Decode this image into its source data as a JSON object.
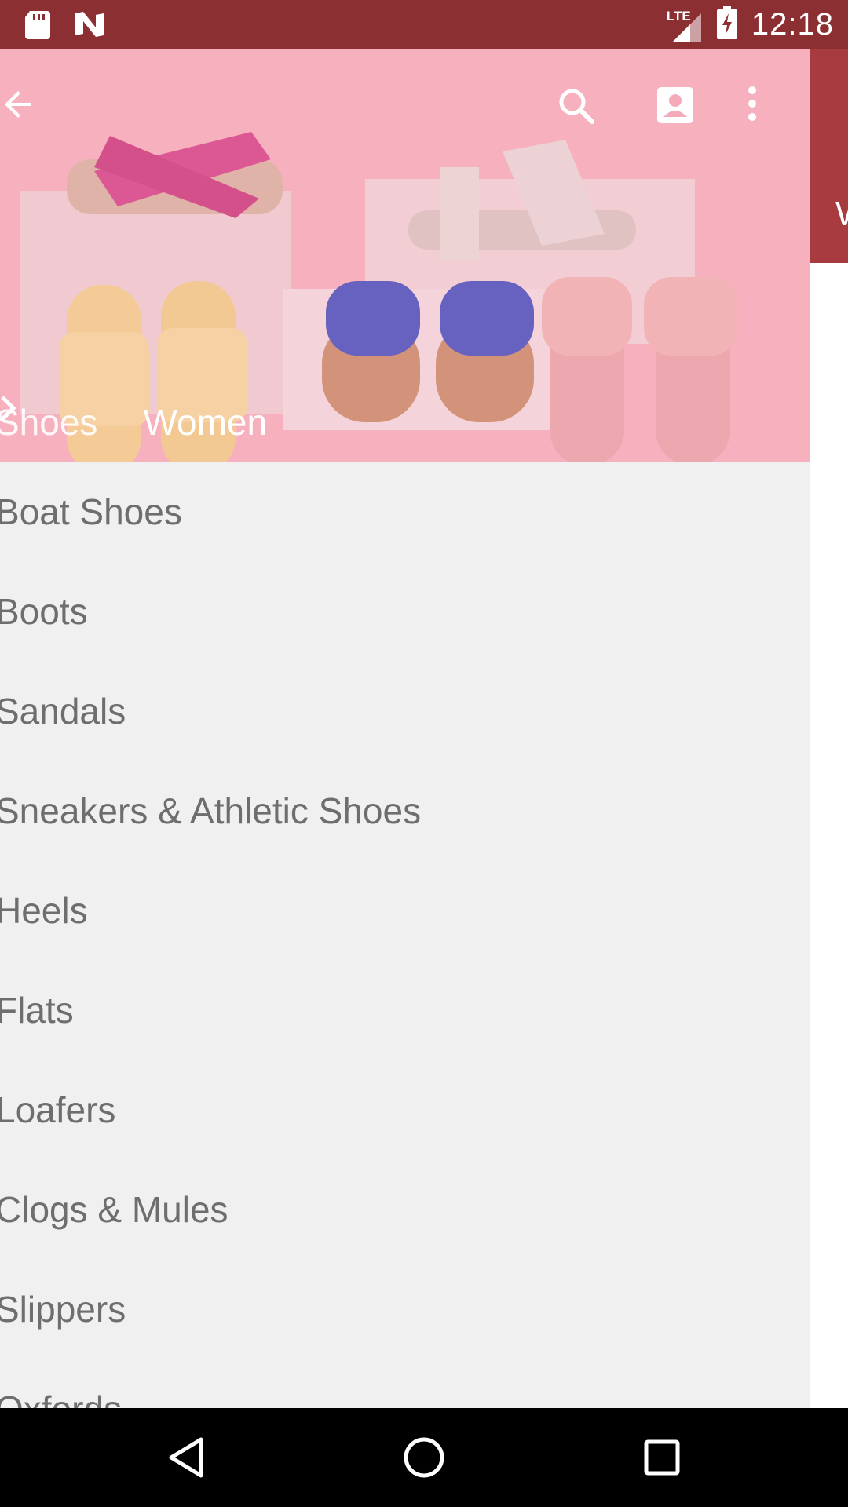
{
  "status_bar": {
    "time": "12:18",
    "network": "LTE",
    "left_icons": [
      "sd-card-icon",
      "n-notification-icon"
    ],
    "right_icons": [
      "lte-signal-icon",
      "battery-charging-icon"
    ]
  },
  "toolbar": {
    "back_icon": "arrow-back-icon",
    "actions": [
      "search-icon",
      "account-icon",
      "more-vert-icon"
    ]
  },
  "breadcrumb": {
    "parent": "Shoes",
    "separator_icon": "chevron-right-icon",
    "current": "Women"
  },
  "categories": [
    {
      "label": "Boat Shoes"
    },
    {
      "label": "Boots"
    },
    {
      "label": "Sandals"
    },
    {
      "label": "Sneakers & Athletic Shoes"
    },
    {
      "label": "Heels"
    },
    {
      "label": "Flats"
    },
    {
      "label": "Loafers"
    },
    {
      "label": "Clogs & Mules"
    },
    {
      "label": "Slippers"
    },
    {
      "label": "Oxfords"
    }
  ],
  "background_panel": {
    "partial_text": "W"
  },
  "nav_bar": {
    "buttons": [
      "back-triangle-icon",
      "home-circle-icon",
      "recents-square-icon"
    ]
  },
  "colors": {
    "status_bar": "#8c2f33",
    "hero_pink": "#f6b1be",
    "list_bg": "#f0f0f0",
    "list_text": "#6e6e6e",
    "peek_panel": "#a73b3f"
  }
}
